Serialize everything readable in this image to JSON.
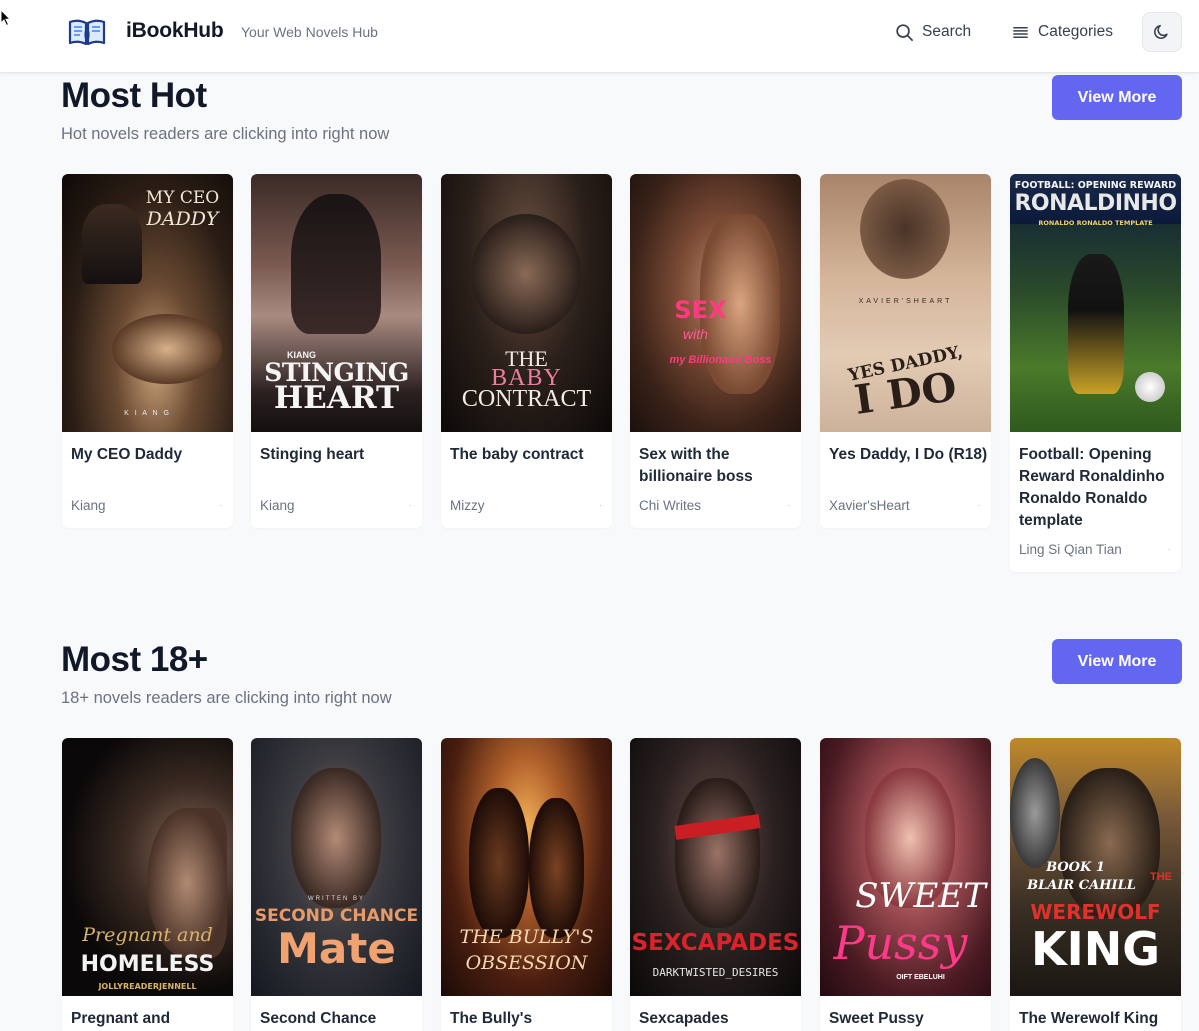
{
  "header": {
    "brand": "iBookHub",
    "tagline": "Your Web Novels Hub",
    "search_label": "Search",
    "categories_label": "Categories",
    "icons": [
      "open-book-icon",
      "search-icon",
      "menu-lines-icon",
      "moon-icon"
    ]
  },
  "colors": {
    "accent": "#6366f1",
    "page_bg": "#f8f9fb",
    "card_bg": "#ffffff"
  },
  "sections": [
    {
      "title": "Most Hot",
      "subtitle": "Hot novels readers are clicking into right now",
      "view_more": "View More",
      "books": [
        {
          "title": "My CEO Daddy",
          "author": "Kiang",
          "dot": "·",
          "cover": {
            "line1": "MY CEO",
            "line2": "DADDY",
            "footer": "K I A N G"
          }
        },
        {
          "title": "Stinging heart",
          "author": "Kiang",
          "dot": "·",
          "cover": {
            "line1": "KIANG",
            "line2": "STINGING",
            "line3": "HEART"
          }
        },
        {
          "title": "The baby contract",
          "author": "Mizzy",
          "dot": "·",
          "cover": {
            "line1": "THE",
            "line2": "BABY",
            "line3": "CONTRACT"
          }
        },
        {
          "title": "Sex with the billionaire boss",
          "author": "Chi Writes",
          "dot": "·",
          "cover": {
            "line1": "SEX",
            "line2": "with",
            "line3": "my Billionaire Boss"
          }
        },
        {
          "title": "Yes Daddy, I Do (R18)",
          "author": "Xavier'sHeart",
          "dot": "·",
          "cover": {
            "line1": "XAVIER'SHEART",
            "line2": "YES DADDY,",
            "line3": "I DO"
          }
        },
        {
          "title": "Football: Opening Reward Ronaldinho Ronaldo Ronaldo template",
          "author": "Ling Si Qian Tian",
          "dot": "·",
          "cover": {
            "line1": "FOOTBALL: OPENING REWARD",
            "line2": "RONALDINHO",
            "line3": "RONALDO RONALDO TEMPLATE"
          }
        }
      ]
    },
    {
      "title": "Most 18+",
      "subtitle": "18+ novels readers are clicking into right now",
      "view_more": "View More",
      "books": [
        {
          "title": "Pregnant and",
          "cover": {
            "line1": "Pregnant and",
            "line2": "HOMELESS",
            "line3": "JOLLYREADERJENNELL"
          }
        },
        {
          "title": "Second Chance",
          "cover": {
            "line1": "SECOND CHANCE",
            "line2": "Mate"
          }
        },
        {
          "title": "The Bully's",
          "cover": {
            "line1": "THE BULLY'S",
            "line2": "OBSESSION"
          }
        },
        {
          "title": "Sexcapades",
          "cover": {
            "line1": "SEXCAPADES",
            "line2": "DARKTWISTED_DESIRES"
          }
        },
        {
          "title": "Sweet Pussy",
          "cover": {
            "line1": "SWEET",
            "line2": "Pussy"
          }
        },
        {
          "title": "The Werewolf King",
          "cover": {
            "line1": "BOOK 1",
            "line2": "BLAIR CAHILL",
            "line3": "KING"
          }
        }
      ]
    }
  ]
}
